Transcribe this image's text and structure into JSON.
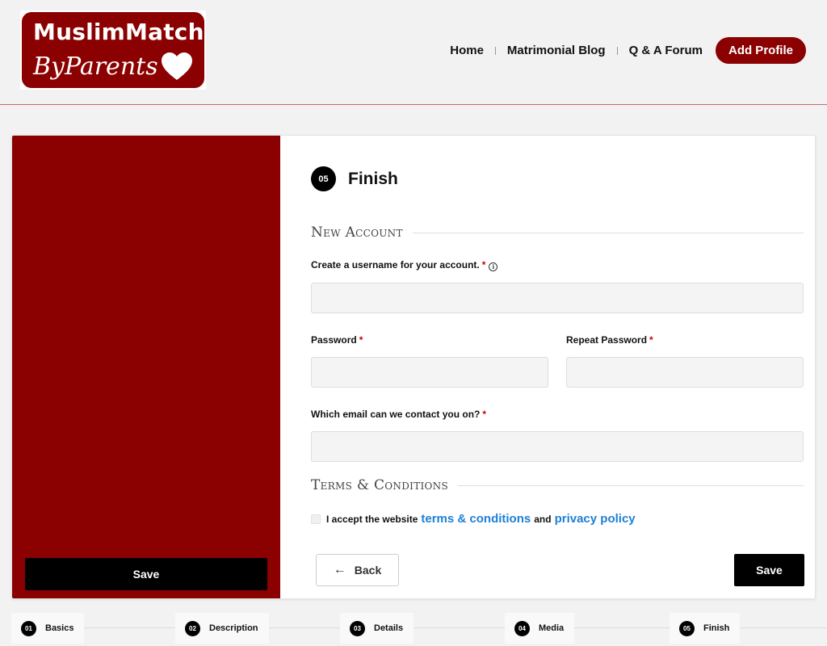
{
  "brand": {
    "title": "MuslimMatch",
    "subtitle": "ByParents",
    "color": "#8b0000"
  },
  "nav": {
    "items": [
      "Home",
      "Matrimonial Blog",
      "Q & A Forum"
    ],
    "cta": "Add Profile"
  },
  "sidebar": {
    "save_label": "Save"
  },
  "form": {
    "step_number": "05",
    "step_title": "Finish",
    "section_account": "New Account",
    "username_label": "Create a username for your account.",
    "username_value": "",
    "password_label": "Password",
    "password_value": "",
    "repeat_password_label": "Repeat Password",
    "repeat_password_value": "",
    "email_label": "Which email can we contact you on?",
    "email_value": "",
    "required_mark": "*",
    "info_icon": "i",
    "section_terms": "Terms & Conditions",
    "terms_prefix": "I accept the website",
    "terms_link": "terms & conditions",
    "terms_and": "and",
    "privacy_link": "privacy policy",
    "terms_checked": false,
    "back_label": "Back",
    "back_icon": "←",
    "save_label": "Save"
  },
  "steps": [
    {
      "num": "01",
      "label": "Basics"
    },
    {
      "num": "02",
      "label": "Description"
    },
    {
      "num": "03",
      "label": "Details"
    },
    {
      "num": "04",
      "label": "Media"
    },
    {
      "num": "05",
      "label": "Finish"
    }
  ]
}
